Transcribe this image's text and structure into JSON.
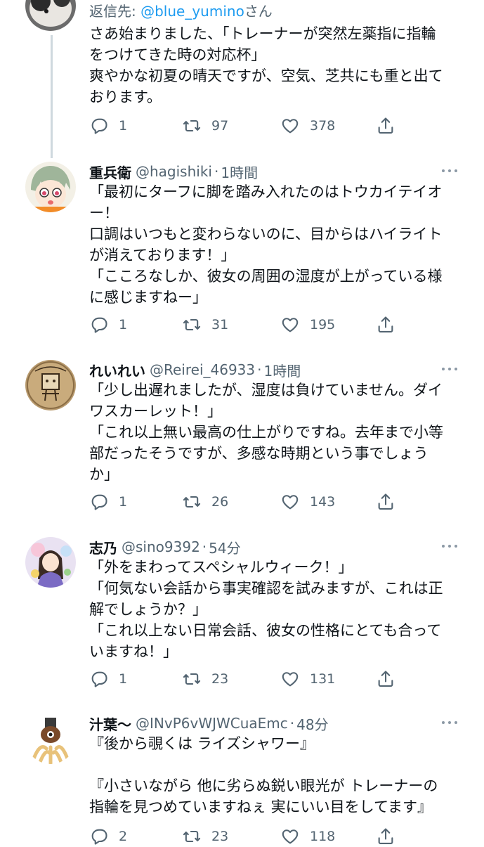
{
  "thread_color": "#cfd9de",
  "accent_color": "#1d9bf0",
  "first": {
    "reply_prefix": "返信先: ",
    "reply_handle": "@blue_yumino",
    "reply_suffix": "さん",
    "lines": [
      "さあ始まりました、「トレーナーが突然左薬指に指輪",
      "をつけてきた時の対応杯」",
      "爽やかな初夏の晴天ですが、空気、芝共にも重と出て",
      "おります。"
    ],
    "reply_count": "1",
    "retweet_count": "97",
    "like_count": "378"
  },
  "tweets": [
    {
      "name": "重兵衛",
      "handle": "@hagishiki",
      "time": "1時間",
      "lines": [
        "「最初にターフに脚を踏み入れたのはトウカイテイオ",
        "ー！",
        "口調はいつもと変わらないのに、目からはハイライト",
        "が消えております！」",
        "「こころなしか、彼女の周囲の湿度が上がっている様",
        "に感じますねー」"
      ],
      "reply_count": "1",
      "retweet_count": "31",
      "like_count": "195"
    },
    {
      "name": "れいれい",
      "handle": "@Reirei_46933",
      "time": "1時間",
      "lines": [
        "「少し出遅れましたが、湿度は負けていません。ダイ",
        "ワスカーレット！」",
        "「これ以上無い最高の仕上がりですね。去年まで小等",
        "部だったそうですが、多感な時期という事でしょう",
        "か」"
      ],
      "reply_count": "1",
      "retweet_count": "26",
      "like_count": "143"
    },
    {
      "name": "志乃",
      "handle": "@sino9392",
      "time": "54分",
      "lines": [
        "「外をまわってスペシャルウィーク！」",
        "「何気ない会話から事実確認を試みますが、これは正",
        "解でしょうか？」",
        "「これ以上ない日常会話、彼女の性格にとても合って",
        "いますね！」"
      ],
      "reply_count": "1",
      "retweet_count": "23",
      "like_count": "131"
    },
    {
      "name": "汁葉〜",
      "handle": "@INvP6vWJWCuaEmc",
      "time": "48分",
      "lines": [
        "『後から覗くは ライズシャワー』",
        "",
        "『小さいながら 他に劣らぬ鋭い眼光が トレーナーの",
        "指輪を見つめていますねぇ 実にいい目をしてます』"
      ],
      "reply_count": "2",
      "retweet_count": "23",
      "like_count": "118"
    }
  ]
}
